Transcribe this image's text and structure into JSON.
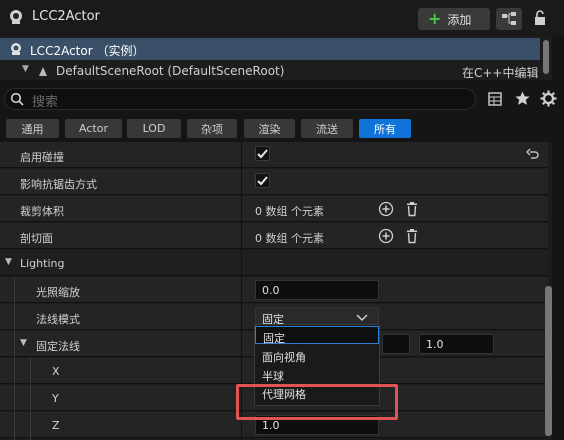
{
  "header": {
    "title": "LCC2Actor",
    "add_label": "添加"
  },
  "tree": {
    "selected": "LCC2Actor （实例）",
    "root_item": "DefaultSceneRoot (DefaultSceneRoot)",
    "root_status": "在C++中编辑"
  },
  "search": {
    "placeholder": "搜索"
  },
  "tabs": [
    "通用",
    "Actor",
    "LOD",
    "杂项",
    "渲染",
    "流送",
    "所有"
  ],
  "active_tab": "所有",
  "properties": {
    "enable_collision": "启用碰撞",
    "aa_mode": "影响抗锯齿方式",
    "clip_volume": "裁剪体积",
    "clip_volume_value": "0 数组 个元素",
    "cut_plane": "剖切面",
    "cut_plane_value": "0 数组 个元素",
    "category_lighting": "Lighting",
    "light_scale": "光照缩放",
    "light_scale_value": "0.0",
    "normal_mode": "法线模式",
    "normal_mode_value": "固定",
    "fixed_normal": "固定法线",
    "fixed_normal_extra": "1.0",
    "x": "X",
    "y": "Y",
    "z": "Z",
    "z_value": "1.0"
  },
  "dropdown": {
    "options": [
      "固定",
      "面向视角",
      "半球",
      "代理网格"
    ]
  },
  "colors": {
    "accent": "#0f73d9",
    "selection": "#3a5068",
    "highlight": "#e05454"
  }
}
